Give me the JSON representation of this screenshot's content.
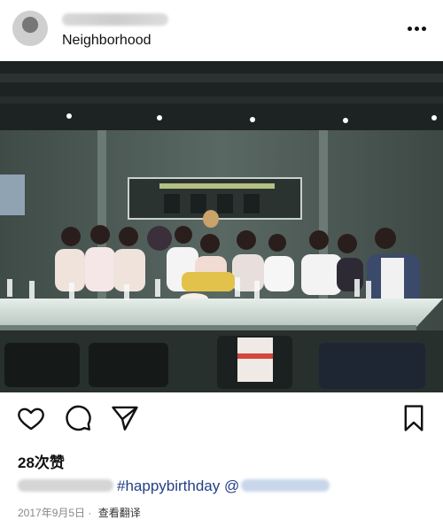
{
  "post": {
    "location": "Neighborhood",
    "likes": "28次赞",
    "caption_hashtag": "#happybirthday",
    "caption_mention_prefix": "@",
    "date": "2017年9月5日 ·",
    "translate_label": "查看翻译"
  },
  "icons": {
    "more": "more-options-icon",
    "like": "heart-icon",
    "comment": "comment-bubble-icon",
    "share": "send-icon",
    "save": "bookmark-icon"
  },
  "colors": {
    "hashtag": "#233f86",
    "meta_text": "#888888",
    "photo_wall": "#4d5a55"
  }
}
